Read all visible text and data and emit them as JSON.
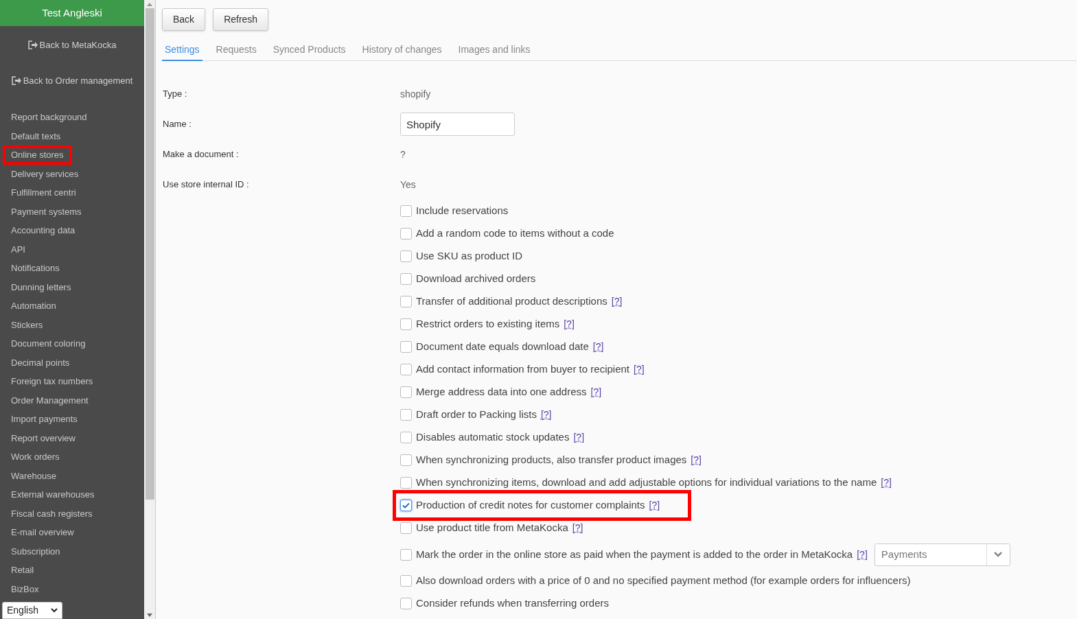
{
  "sidebar": {
    "title": "Test Angleski",
    "back_links": [
      {
        "label": "Back to MetaKocka"
      },
      {
        "label": "Back to Order management"
      }
    ],
    "items": [
      {
        "label": "Report background",
        "highlighted": false
      },
      {
        "label": "Default texts",
        "highlighted": false
      },
      {
        "label": "Online stores",
        "highlighted": true
      },
      {
        "label": "Delivery services",
        "highlighted": false
      },
      {
        "label": "Fulfillment centri",
        "highlighted": false
      },
      {
        "label": "Payment systems",
        "highlighted": false
      },
      {
        "label": "Accounting data",
        "highlighted": false
      },
      {
        "label": "API",
        "highlighted": false
      },
      {
        "label": "Notifications",
        "highlighted": false
      },
      {
        "label": "Dunning letters",
        "highlighted": false
      },
      {
        "label": "Automation",
        "highlighted": false
      },
      {
        "label": "Stickers",
        "highlighted": false
      },
      {
        "label": "Document coloring",
        "highlighted": false
      },
      {
        "label": "Decimal points",
        "highlighted": false
      },
      {
        "label": "Foreign tax numbers",
        "highlighted": false
      },
      {
        "label": "Order Management",
        "highlighted": false
      },
      {
        "label": "Import payments",
        "highlighted": false
      },
      {
        "label": "Report overview",
        "highlighted": false
      },
      {
        "label": "Work orders",
        "highlighted": false
      },
      {
        "label": "Warehouse",
        "highlighted": false
      },
      {
        "label": "External warehouses",
        "highlighted": false
      },
      {
        "label": "Fiscal cash registers",
        "highlighted": false
      },
      {
        "label": "E-mail overview",
        "highlighted": false
      },
      {
        "label": "Subscription",
        "highlighted": false
      },
      {
        "label": "Retail",
        "highlighted": false
      },
      {
        "label": "BizBox",
        "highlighted": false
      }
    ],
    "language": "English"
  },
  "buttons": [
    "Back",
    "Refresh"
  ],
  "tabs": [
    {
      "label": "Settings",
      "selected": true
    },
    {
      "label": "Requests",
      "selected": false
    },
    {
      "label": "Synced Products",
      "selected": false
    },
    {
      "label": "History of changes",
      "selected": false
    },
    {
      "label": "Images and links",
      "selected": false
    }
  ],
  "fields": [
    {
      "label": "Type :",
      "kind": "text",
      "value": "shopify"
    },
    {
      "label": "Name :",
      "kind": "input",
      "value": "Shopify"
    },
    {
      "label": "Make a document :",
      "kind": "text",
      "value": "?"
    },
    {
      "label": "Use store internal ID :",
      "kind": "text",
      "value": "Yes"
    }
  ],
  "options": [
    {
      "label": "Include reservations",
      "checked": false,
      "highlighted": false
    },
    {
      "label": "Add a random code to items without a code",
      "checked": false,
      "highlighted": false
    },
    {
      "label": "Use SKU as product ID",
      "checked": false,
      "highlighted": false
    },
    {
      "label": "Download archived orders",
      "checked": false,
      "highlighted": false
    },
    {
      "label": "Transfer of additional product descriptions",
      "help": "[?]",
      "checked": false,
      "highlighted": false
    },
    {
      "label": "Restrict orders to existing items",
      "help": "[?]",
      "checked": false,
      "highlighted": false
    },
    {
      "label": "Document date equals download date",
      "help": "[?]",
      "checked": false,
      "highlighted": false
    },
    {
      "label": "Add contact information from buyer to recipient",
      "help": "[?]",
      "checked": false,
      "highlighted": false
    },
    {
      "label": "Merge address data into one address",
      "help": "[?]",
      "checked": false,
      "highlighted": false
    },
    {
      "label": "Draft order to Packing lists",
      "help": "[?]",
      "checked": false,
      "highlighted": false
    },
    {
      "label": "Disables automatic stock updates",
      "help": "[?]",
      "checked": false,
      "highlighted": false
    },
    {
      "label": "When synchronizing products, also transfer product images",
      "help": "[?]",
      "checked": false,
      "highlighted": false
    },
    {
      "label": "When synchronizing items, download and add adjustable options for individual variations to the name",
      "help": "[?]",
      "checked": false,
      "highlighted": false
    },
    {
      "label": "Production of credit notes for customer complaints",
      "help": "[?]",
      "checked": true,
      "highlighted": true
    },
    {
      "label": "Use product title from MetaKocka",
      "help": "[?]",
      "checked": false,
      "highlighted": false
    },
    {
      "label": "Mark the order in the online store as paid when the payment is added to the order in MetaKocka",
      "help": "[?]",
      "checked": false,
      "highlighted": false,
      "select": "Payments"
    },
    {
      "label": "Also download orders with a price of 0 and no specified payment method (for example orders for influencers)",
      "checked": false,
      "highlighted": false
    },
    {
      "label": "Consider refunds when transferring orders",
      "checked": false,
      "highlighted": false
    }
  ]
}
